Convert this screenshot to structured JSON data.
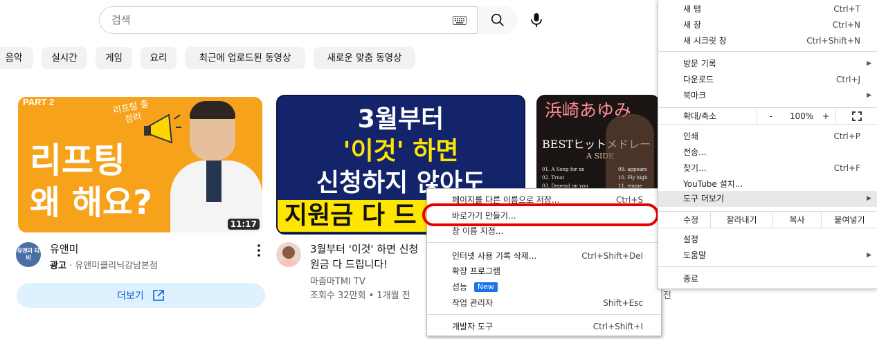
{
  "search": {
    "placeholder": "검색"
  },
  "chips": [
    {
      "label": "음악"
    },
    {
      "label": "실시간"
    },
    {
      "label": "게임"
    },
    {
      "label": "요리"
    },
    {
      "label": "최근에 업로드된 동영상"
    },
    {
      "label": "새로운 맞춤 동영상"
    }
  ],
  "videos": [
    {
      "thumb_tag": "PART 2",
      "thumb_small": "리프팅 총정리",
      "thumb_big_1": "리프팅",
      "thumb_big_2": "왜 해요?",
      "duration": "11:17",
      "avatar_text": "유앤미 티비",
      "title": "유앤미",
      "ad_label": "광고",
      "channel": "· 유앤미클리닉강남본점",
      "more_label": "더보기"
    },
    {
      "thumb_line1": "3월부터",
      "thumb_line2": "'이것' 하면",
      "thumb_line3": "신청하지 않아도",
      "thumb_line4": "지원금 다 드",
      "title_line1": "3월부터 '이것' 하면 신청",
      "title_line2": "원금 다 드립니다!",
      "channel": "마즘마TMI TV",
      "stats": "조회수 32만회 • 1개월 전"
    },
    {
      "thumb_title": "浜崎あゆみ",
      "thumb_sub": "BESTヒットメドレー",
      "thumb_side": "A SIDE",
      "tracks_left": [
        "01. A Song for xx",
        "02. Trust",
        "03. Depend on you"
      ],
      "tracks_right": [
        "09. appears",
        "10. Fly high",
        "11. vogue"
      ],
      "stats_tail": "전"
    }
  ],
  "submenu": {
    "items": [
      {
        "label": "페이지를 다른 이름으로 저장...",
        "shortcut": "Ctrl+S"
      },
      {
        "label": "바로가기 만들기...",
        "shortcut": ""
      },
      {
        "label": "창 이름 지정...",
        "shortcut": ""
      },
      {
        "label": "인터넷 사용 기록 삭제...",
        "shortcut": "Ctrl+Shift+Del"
      },
      {
        "label": "확장 프로그램",
        "shortcut": ""
      },
      {
        "label": "성능",
        "shortcut": "",
        "badge": "New"
      },
      {
        "label": "작업 관리자",
        "shortcut": "Shift+Esc"
      },
      {
        "label": "개발자 도구",
        "shortcut": "Ctrl+Shift+I"
      }
    ]
  },
  "mainmenu": {
    "new_tab": {
      "label": "새 탭",
      "shortcut": "Ctrl+T"
    },
    "new_window": {
      "label": "새 창",
      "shortcut": "Ctrl+N"
    },
    "incognito": {
      "label": "새 시크릿 창",
      "shortcut": "Ctrl+Shift+N"
    },
    "history": {
      "label": "방문 기록"
    },
    "downloads": {
      "label": "다운로드",
      "shortcut": "Ctrl+J"
    },
    "bookmarks": {
      "label": "북마크"
    },
    "zoom": {
      "label": "확대/축소",
      "minus": "-",
      "value": "100%",
      "plus": "+"
    },
    "print": {
      "label": "인쇄",
      "shortcut": "Ctrl+P"
    },
    "cast": {
      "label": "전송..."
    },
    "find": {
      "label": "찾기...",
      "shortcut": "Ctrl+F"
    },
    "install": {
      "label": "YouTube 설치..."
    },
    "more_tools": {
      "label": "도구 더보기"
    },
    "edit": {
      "label": "수정",
      "cut": "잘라내기",
      "copy": "복사",
      "paste": "붙여넣기"
    },
    "settings": {
      "label": "설정"
    },
    "help": {
      "label": "도움말"
    },
    "exit": {
      "label": "종료"
    }
  },
  "colors": {
    "accent_blue": "#065fd4",
    "highlight_red": "#e60000",
    "thumb_orange": "#f7a21b",
    "thumb_navy": "#14246b",
    "thumb_yellow": "#ffe600"
  }
}
